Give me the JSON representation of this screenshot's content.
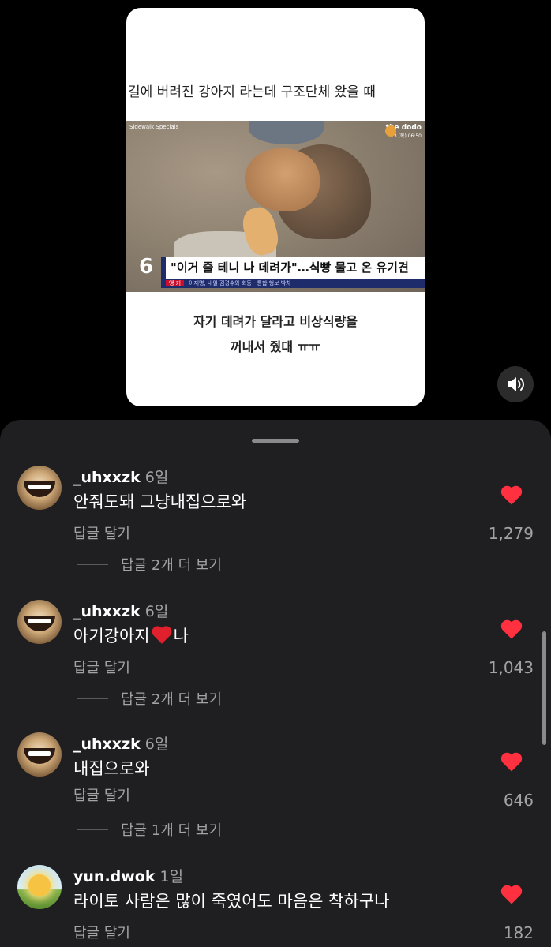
{
  "video": {
    "top_caption": "길에 버려진 강아지 라는데 구조단체 왔을 때",
    "source": "Sidewalk Specials",
    "logo_text": "the dodo",
    "timestamp": "13 (목) 06:50",
    "channel_number": "6",
    "news_headline": "\"이거 줄 테니 나 데려가\"…식빵 물고 온 유기견",
    "news_tag": "앵 커",
    "news_sub": "이재명, 내일 김경수와 회동 · 통합 행보 박차",
    "bottom_caption_line1": "자기 데려가 달라고 비상식량을",
    "bottom_caption_line2": "꺼내서 줬대 ㅠㅠ"
  },
  "sound_button": {
    "icon": "speaker-icon"
  },
  "comments": [
    {
      "username": "_uhxxzk",
      "age": "6일",
      "text": "안줘도돼 그냥내집으로와",
      "reply_label": "답글 달기",
      "likes": "1,279",
      "more_replies": "답글 2개 더 보기"
    },
    {
      "username": "_uhxxzk",
      "age": "6일",
      "text_before": "아기강아지",
      "text_after": "나",
      "reply_label": "답글 달기",
      "likes": "1,043",
      "more_replies": "답글 2개 더 보기"
    },
    {
      "username": "_uhxxzk",
      "age": "6일",
      "text": "내집으로와",
      "reply_label": "답글 달기",
      "likes": "646",
      "more_replies": "답글 1개 더 보기"
    },
    {
      "username": "yun.dwok",
      "age": "1일",
      "text": "라이토 사람은 많이 죽였어도 마음은 착하구나",
      "reply_label": "답글 달기",
      "likes": "182"
    }
  ],
  "colors": {
    "sheet_bg": "#1f1f21",
    "heart": "#ff3040",
    "muted_text": "#a3a3a6"
  }
}
